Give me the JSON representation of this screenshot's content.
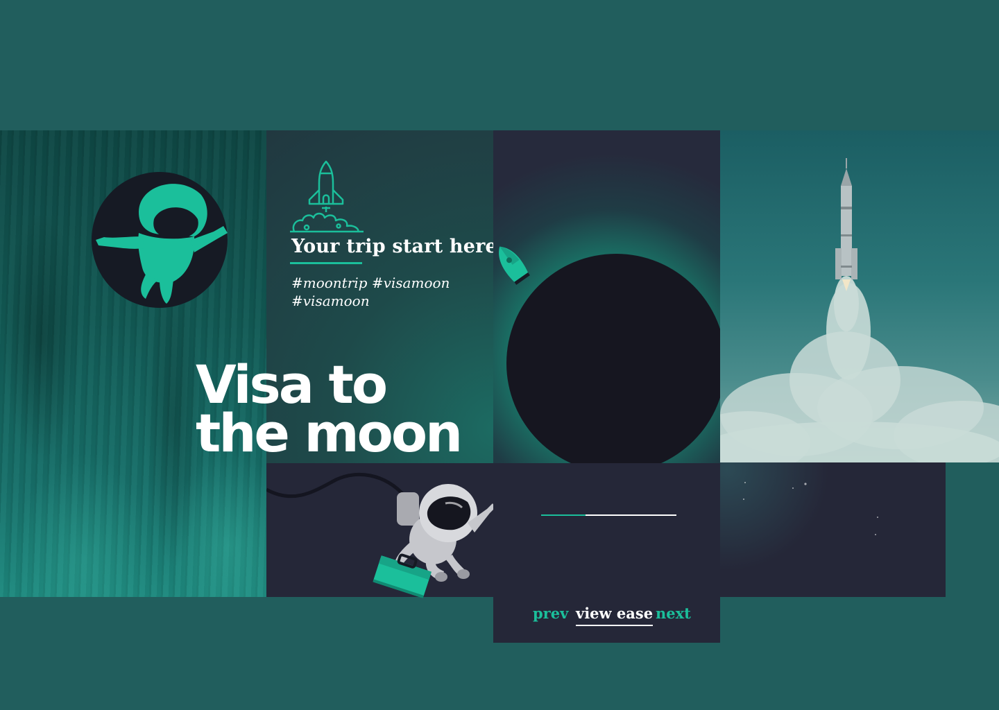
{
  "hero": {
    "subtitle": "Your trip start here",
    "hashtags": "#moontrip #visamoon #visamoon",
    "headline_line1": "Visa to",
    "headline_line2": "the moon"
  },
  "slider": {
    "progress": 0.33
  },
  "nav": {
    "prev_label": "prev",
    "view_label": "view ease",
    "next_label": "next"
  },
  "colors": {
    "background": "#215e5d",
    "accent": "#1bbf9b",
    "dark_panel": "#252738",
    "eclipse": "#161620",
    "text": "#ffffff"
  },
  "icons": [
    "astronaut-logo-icon",
    "rocket-launch-icon",
    "rocket-icon",
    "astronaut-icon",
    "briefcase-icon"
  ]
}
